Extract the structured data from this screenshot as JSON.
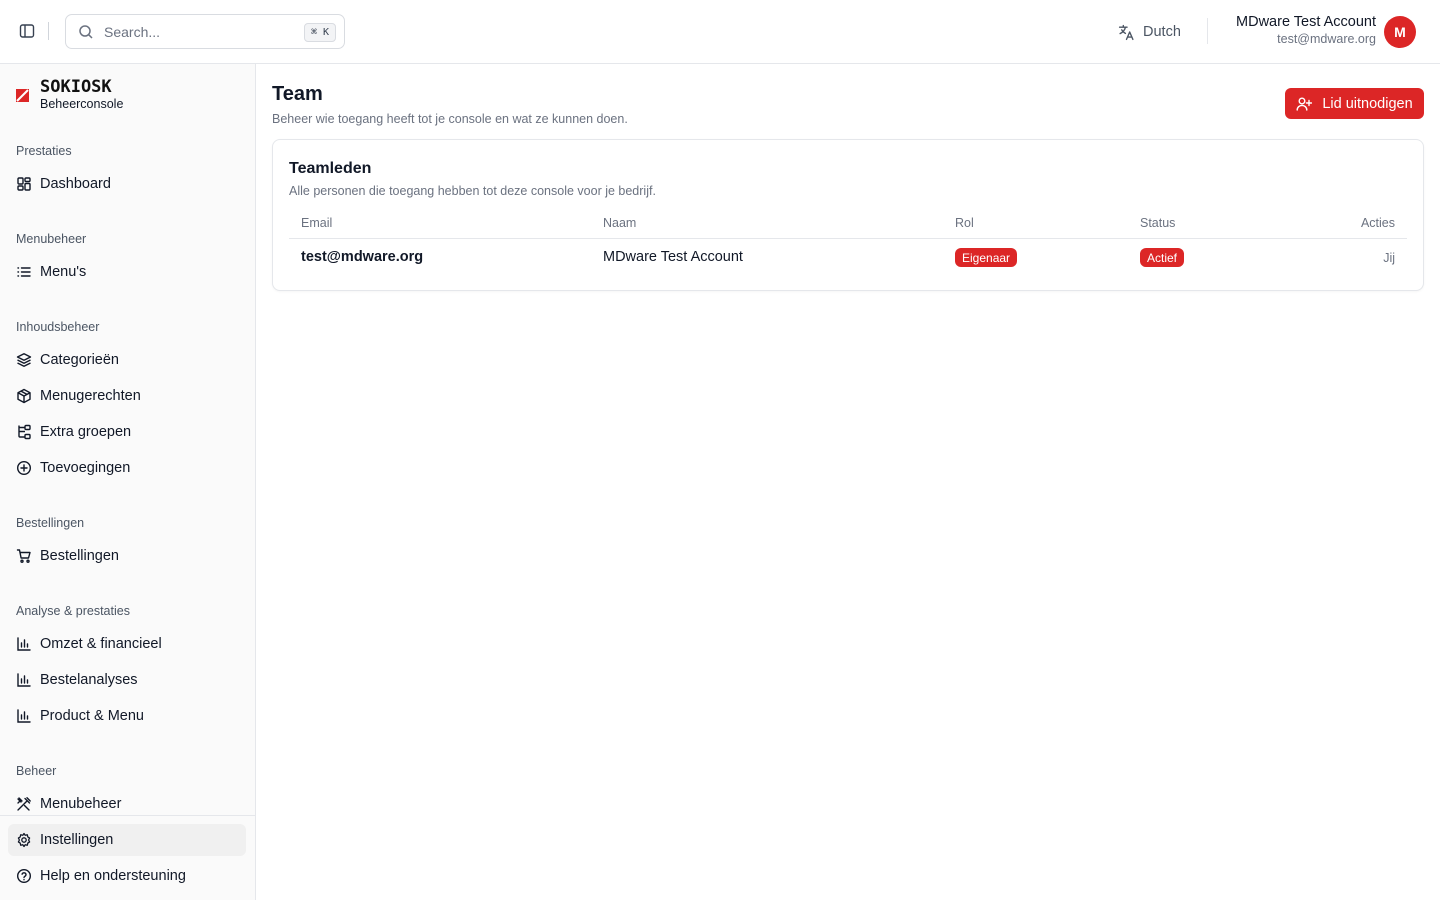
{
  "header": {
    "search_placeholder": "Search...",
    "search_shortcut": "⌘ K",
    "language": "Dutch",
    "user_name": "MDware Test Account",
    "user_email": "test@mdware.org",
    "avatar_initial": "M"
  },
  "brand": {
    "logo_text": "SOKIOSK",
    "subtitle": "Beheerconsole",
    "accent_color": "#dc2626"
  },
  "sidebar": {
    "groups": [
      {
        "label": "Prestaties"
      },
      {
        "label": "Menubeheer"
      },
      {
        "label": "Inhoudsbeheer"
      },
      {
        "label": "Bestellingen"
      },
      {
        "label": "Analyse & prestaties"
      },
      {
        "label": "Beheer"
      }
    ],
    "items": [
      {
        "label": "Dashboard",
        "icon": "dashboard-icon"
      },
      {
        "label": "Menu's",
        "icon": "list-icon"
      },
      {
        "label": "Categorieën",
        "icon": "layers-icon"
      },
      {
        "label": "Menugerechten",
        "icon": "package-icon"
      },
      {
        "label": "Extra groepen",
        "icon": "tree-icon"
      },
      {
        "label": "Toevoegingen",
        "icon": "plus-circle-icon"
      },
      {
        "label": "Bestellingen",
        "icon": "cart-icon"
      },
      {
        "label": "Omzet & financieel",
        "icon": "bar-chart-icon"
      },
      {
        "label": "Bestelanalyses",
        "icon": "bar-chart-icon"
      },
      {
        "label": "Product & Menu",
        "icon": "bar-chart-icon"
      },
      {
        "label": "Menubeheer",
        "icon": "utensils-icon"
      }
    ],
    "footer_items": [
      {
        "label": "Instellingen",
        "icon": "gear-icon",
        "active": true
      },
      {
        "label": "Help en ondersteuning",
        "icon": "help-circle-icon"
      }
    ]
  },
  "page": {
    "title": "Team",
    "subtitle": "Beheer wie toegang heeft tot je console en wat ze kunnen doen.",
    "invite_button": "Lid uitnodigen"
  },
  "card": {
    "title": "Teamleden",
    "description": "Alle personen die toegang hebben tot deze console voor je bedrijf.",
    "columns": [
      "Email",
      "Naam",
      "Rol",
      "Status",
      "Acties"
    ],
    "rows": [
      {
        "email": "test@mdware.org",
        "name": "MDware Test Account",
        "role": "Eigenaar",
        "status": "Actief",
        "actions": "Jij"
      }
    ]
  }
}
